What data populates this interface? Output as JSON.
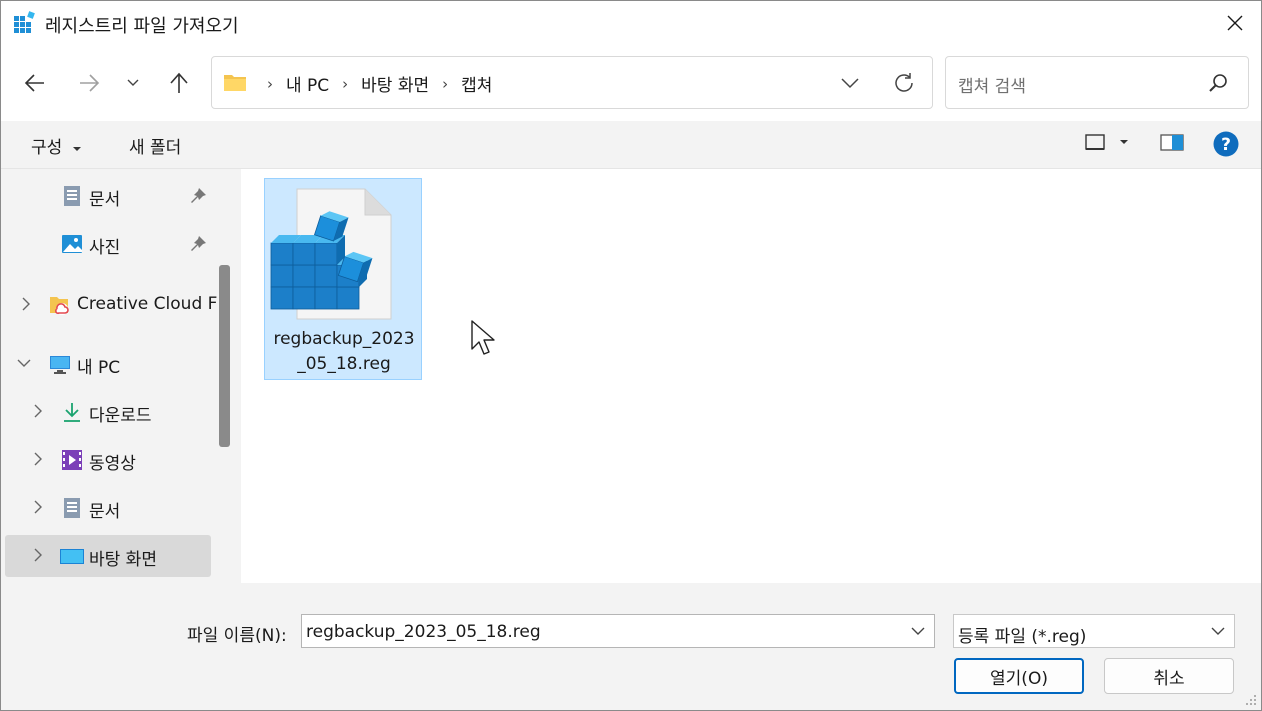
{
  "window": {
    "title": "레지스트리 파일 가져오기"
  },
  "nav": {
    "breadcrumbs": [
      "내 PC",
      "바탕 화면",
      "캡쳐"
    ],
    "search_placeholder": "캡쳐 검색"
  },
  "commands": {
    "organize": "구성",
    "new_folder": "새 폴더"
  },
  "tree": [
    {
      "label": "문서",
      "icon": "document-icon",
      "pinned": true
    },
    {
      "label": "사진",
      "icon": "pictures-icon",
      "pinned": true
    },
    {
      "label": "Creative Cloud F",
      "icon": "creative-cloud-folder-icon"
    },
    {
      "label": "내 PC",
      "icon": "pc-icon",
      "expanded": true
    },
    {
      "label": "다운로드",
      "icon": "download-icon"
    },
    {
      "label": "동영상",
      "icon": "video-icon"
    },
    {
      "label": "문서",
      "icon": "document-icon"
    },
    {
      "label": "바탕 화면",
      "icon": "desktop-icon",
      "selected": true
    }
  ],
  "files": [
    {
      "name_line1": "regbackup_2023",
      "name_line2": "_05_18.reg",
      "icon": "registry-file-icon",
      "selected": true
    }
  ],
  "footer": {
    "filename_label": "파일 이름(N):",
    "filename_value": "regbackup_2023_05_18.reg",
    "filetype_value": "등록 파일 (*.reg)",
    "open_label": "열기(O)",
    "cancel_label": "취소"
  },
  "colors": {
    "accent": "#0067c0",
    "selection": "#cce8ff",
    "help": "#0f6cbd"
  }
}
